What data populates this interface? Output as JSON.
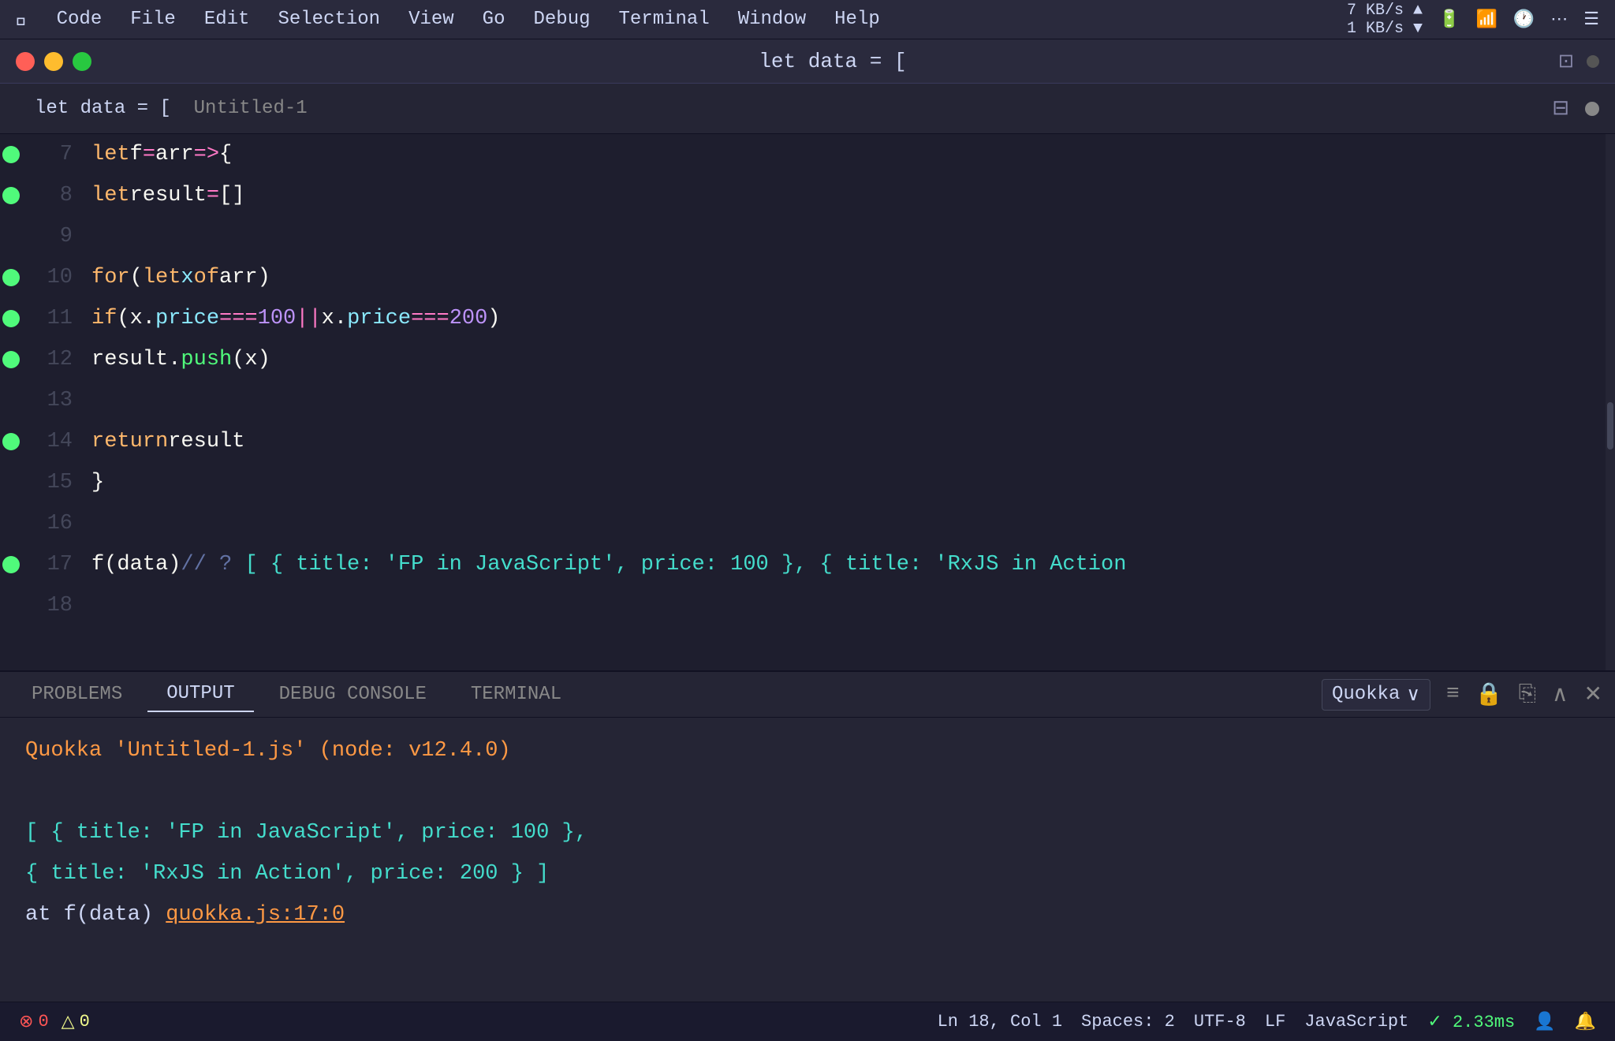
{
  "menubar": {
    "apple": "&#63743;",
    "items": [
      "Code",
      "File",
      "Edit",
      "Selection",
      "View",
      "Go",
      "Debug",
      "Terminal",
      "Window",
      "Help"
    ]
  },
  "titlebar": {
    "title": "let data = [",
    "network": "7 KB/s ▲  1 KB/s ▼",
    "battery_icon": "🔋",
    "wifi_icon": "📶",
    "time_icon": "🕐"
  },
  "tabbar": {
    "label": "let data = [",
    "filename": "Untitled-1"
  },
  "code": {
    "lines": [
      {
        "num": "7",
        "dot": true,
        "content_html": "<span class='kw-orange'>let</span> <span class='kw-white'>f</span> <span class='kw-op'>=</span> <span class='kw-white'>arr</span> <span class='kw-op'>=&gt;</span> <span class='kw-white'>{</span>"
      },
      {
        "num": "8",
        "dot": true,
        "content_html": "    <span class='kw-orange'>let</span> <span class='kw-white'>result</span> <span class='kw-op'>=</span> <span class='kw-white'>[]</span>"
      },
      {
        "num": "9",
        "dot": false,
        "content_html": ""
      },
      {
        "num": "10",
        "dot": true,
        "content_html": "    <span class='kw-orange'>for</span> <span class='kw-white'>(</span><span class='kw-orange'>let</span> <span class='kw-cyan'>x</span> <span class='kw-orange'>of</span> <span class='kw-white'>arr)</span>"
      },
      {
        "num": "11",
        "dot": true,
        "content_html": "      <span class='kw-orange'>if</span> <span class='kw-white'>(x.</span><span class='kw-cyan'>price</span> <span class='kw-op'>===</span> <span class='kw-num'>100</span> <span class='kw-op'>||</span>  <span class='kw-white'>x.</span><span class='kw-cyan'>price</span> <span class='kw-op'>===</span> <span class='kw-num'>200</span><span class='kw-white'>)</span>"
      },
      {
        "num": "12",
        "dot": true,
        "content_html": "        <span class='kw-white'>result.</span><span class='kw-green'>push</span><span class='kw-white'>(x)</span>"
      },
      {
        "num": "13",
        "dot": false,
        "content_html": ""
      },
      {
        "num": "14",
        "dot": true,
        "content_html": "    <span class='kw-orange'>return</span> <span class='kw-white'>result</span>"
      },
      {
        "num": "15",
        "dot": false,
        "content_html": "  <span class='kw-white'>}</span>"
      },
      {
        "num": "16",
        "dot": false,
        "content_html": ""
      },
      {
        "num": "17",
        "dot": true,
        "content_html": "<span class='kw-white'>f(data)</span> <span class='kw-gray'>// ? </span><span class='quokka-teal'>[ { title: 'FP in JavaScript', price: 100 }, { title: 'RxJS in Action</span>"
      },
      {
        "num": "18",
        "dot": false,
        "content_html": ""
      }
    ]
  },
  "panel": {
    "tabs": [
      "PROBLEMS",
      "OUTPUT",
      "DEBUG CONSOLE",
      "TERMINAL"
    ],
    "active_tab": "OUTPUT",
    "selector_value": "Quokka",
    "output_line1": "Quokka 'Untitled-1.js' (node: v12.4.0)",
    "output_line2": "",
    "output_line3": "[ { title: 'FP in JavaScript', price: 100 },",
    "output_line4": "  { title: 'RxJS in Action', price: 200 } ]",
    "output_line5": "  at f(data) quokka.js:17:0"
  },
  "statusbar": {
    "errors": "0",
    "warnings": "0",
    "position": "Ln 18, Col 1",
    "spaces": "Spaces: 2",
    "encoding": "UTF-8",
    "line_ending": "LF",
    "language": "JavaScript",
    "quokka": "✓ 2.33ms",
    "bell_icon": "🔔",
    "person_icon": "👤"
  }
}
